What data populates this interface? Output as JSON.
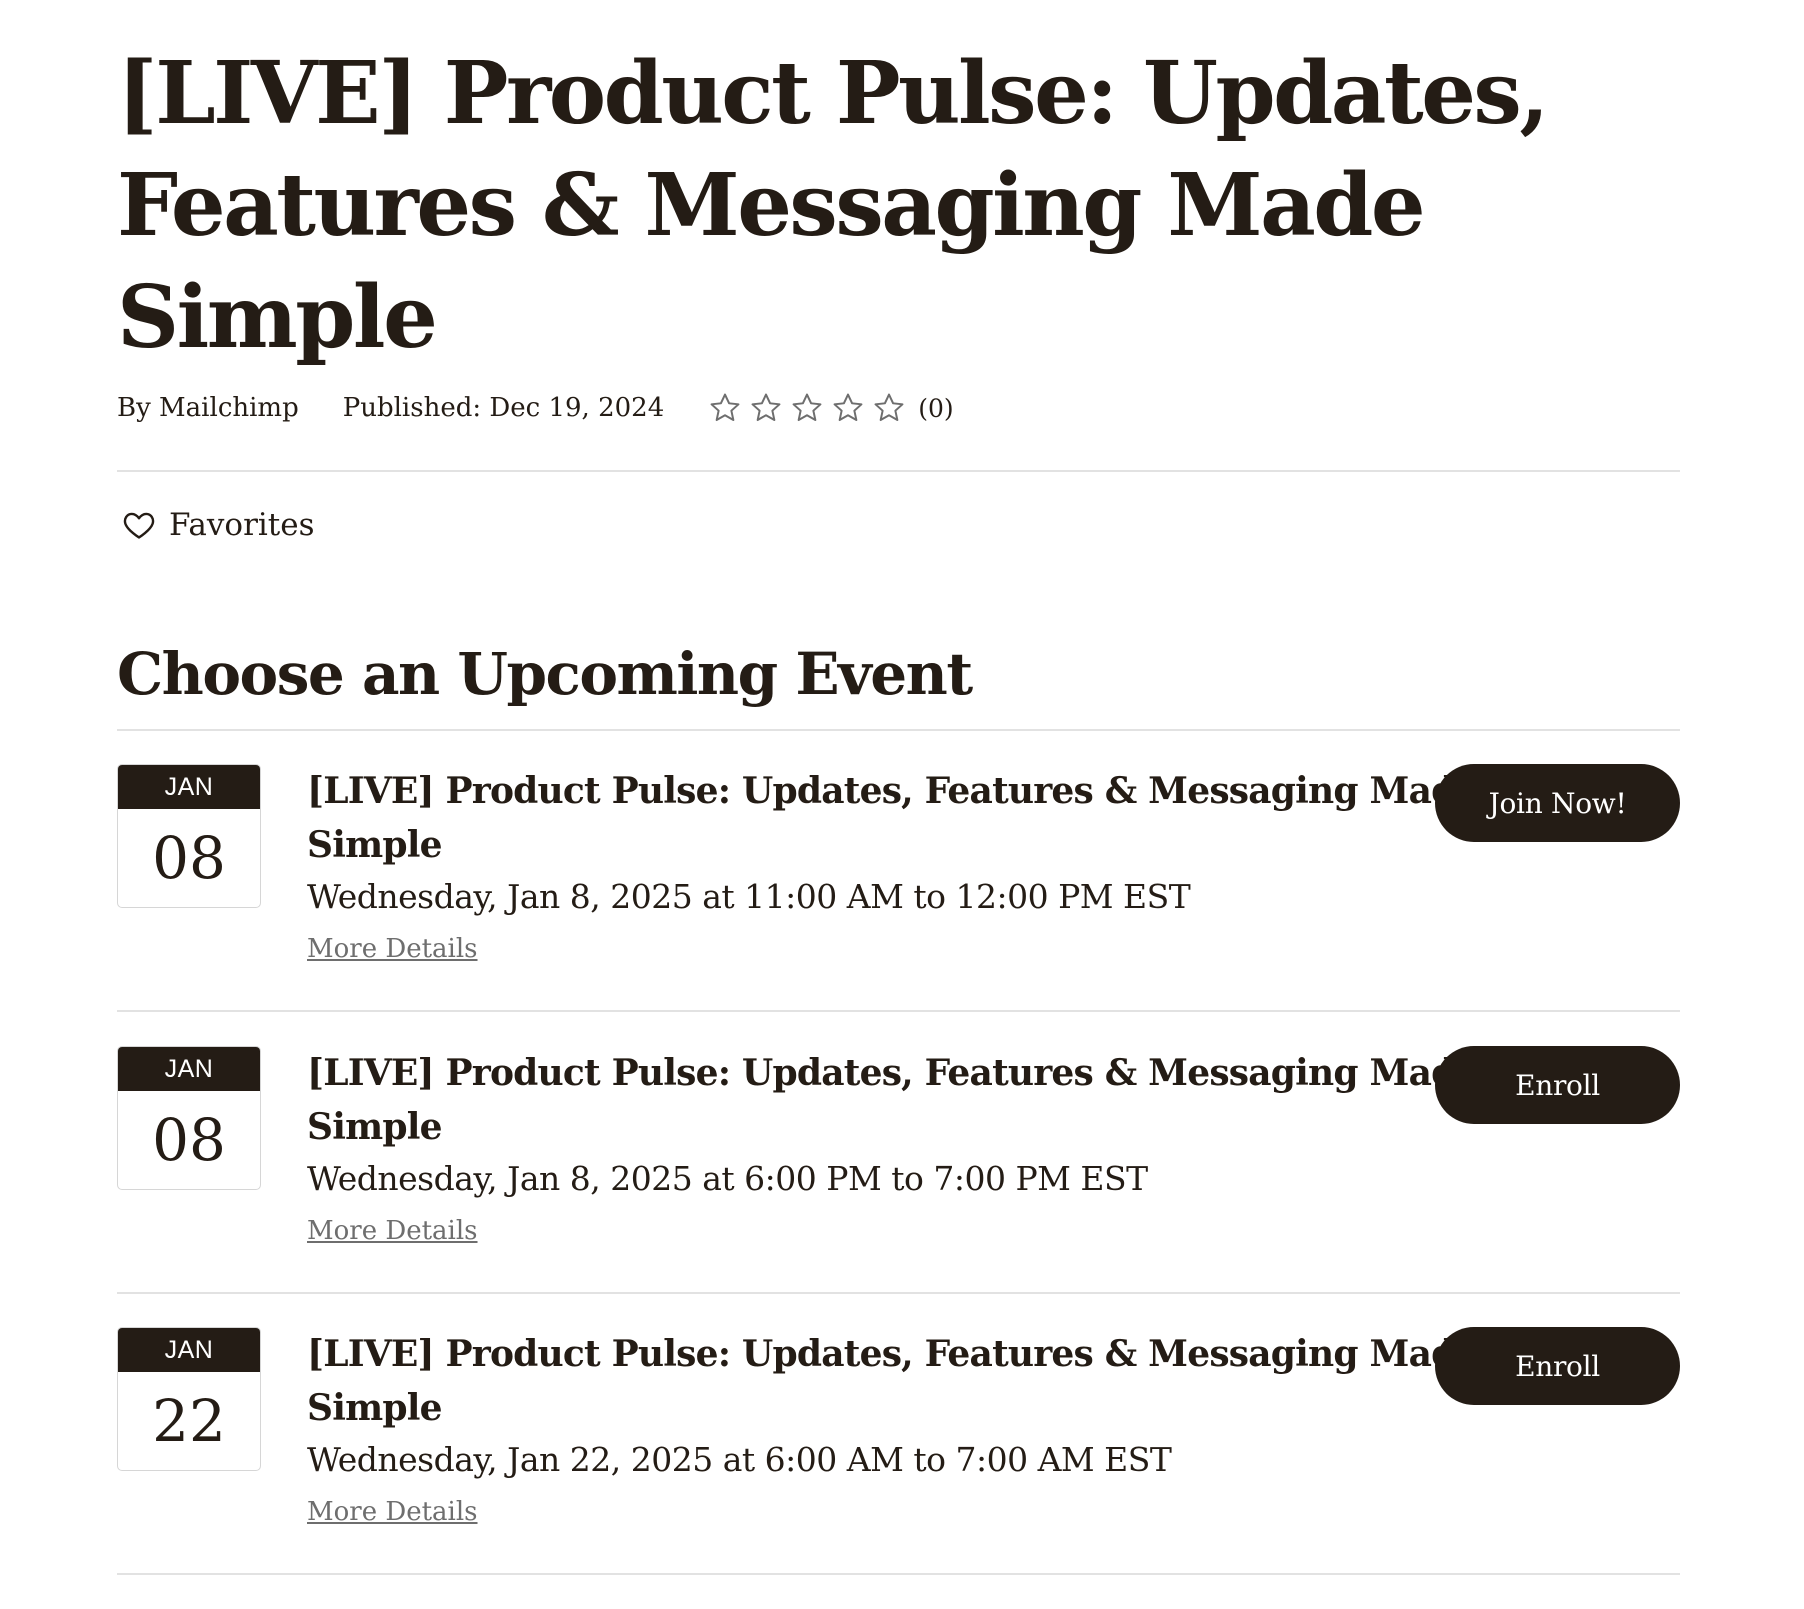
{
  "page": {
    "title": "[LIVE] Product Pulse: Updates, Features & Messaging Made Simple"
  },
  "meta": {
    "author": "By Mailchimp",
    "published": "Published: Dec 19, 2024",
    "rating_value": 0,
    "rating_max": 5,
    "rating_count": "(0)"
  },
  "favorites": {
    "label": "Favorites"
  },
  "events_section": {
    "title": "Choose an Upcoming Event",
    "events": [
      {
        "month": "JAN",
        "day": "08",
        "title": "[LIVE] Product Pulse: Updates, Features & Messaging Made Simple",
        "time": "Wednesday, Jan 8, 2025 at 11:00 AM to 12:00 PM EST",
        "details_label": "More Details",
        "button_label": "Join Now!"
      },
      {
        "month": "JAN",
        "day": "08",
        "title": "[LIVE] Product Pulse: Updates, Features & Messaging Made Simple",
        "time": "Wednesday, Jan 8, 2025 at 6:00 PM to 7:00 PM EST",
        "details_label": "More Details",
        "button_label": "Enroll"
      },
      {
        "month": "JAN",
        "day": "22",
        "title": "[LIVE] Product Pulse: Updates, Features & Messaging Made Simple",
        "time": "Wednesday, Jan 22, 2025 at 6:00 AM to 7:00 AM EST",
        "details_label": "More Details",
        "button_label": "Enroll"
      }
    ]
  },
  "icons": {
    "star": "star-outline-icon",
    "heart": "heart-outline-icon"
  },
  "colors": {
    "text": "#241c15",
    "button_bg": "#241c15",
    "button_text": "#ffffff",
    "link": "#6e6e6e",
    "divider": "#e2e2e2"
  }
}
